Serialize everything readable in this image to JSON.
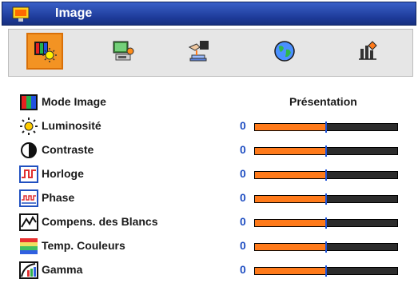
{
  "window": {
    "title": "Image"
  },
  "tabs": [
    {
      "name": "tab-image",
      "icon": "image-settings-icon",
      "active": true
    },
    {
      "name": "tab-display",
      "icon": "display-settings-icon",
      "active": false
    },
    {
      "name": "tab-setup",
      "icon": "setup-hand-icon",
      "active": false
    },
    {
      "name": "tab-language",
      "icon": "globe-icon",
      "active": false
    },
    {
      "name": "tab-options",
      "icon": "options-chart-icon",
      "active": false
    }
  ],
  "items": [
    {
      "label": "Mode Image",
      "icon": "color-bars-icon",
      "type": "select",
      "value": "Présentation"
    },
    {
      "label": "Luminosité",
      "icon": "sun-icon",
      "type": "slider",
      "value": "0",
      "level": 0.5
    },
    {
      "label": "Contraste",
      "icon": "contrast-icon",
      "type": "slider",
      "value": "0",
      "level": 0.5
    },
    {
      "label": "Horloge",
      "icon": "clock-wave-icon",
      "type": "slider",
      "value": "0",
      "level": 0.5
    },
    {
      "label": "Phase",
      "icon": "phase-wave-icon",
      "type": "slider",
      "value": "0",
      "level": 0.5
    },
    {
      "label": "Compens. des Blancs",
      "icon": "white-balance-icon",
      "type": "slider",
      "value": "0",
      "level": 0.5
    },
    {
      "label": "Temp. Couleurs",
      "icon": "color-temp-icon",
      "type": "slider",
      "value": "0",
      "level": 0.5
    },
    {
      "label": "Gamma",
      "icon": "gamma-icon",
      "type": "slider",
      "value": "0",
      "level": 0.5
    }
  ],
  "colors": {
    "accent": "#f39323",
    "titlebar": "#1d3a98",
    "slider_fill": "#ff7a1a",
    "value_text": "#1f4ec2"
  }
}
